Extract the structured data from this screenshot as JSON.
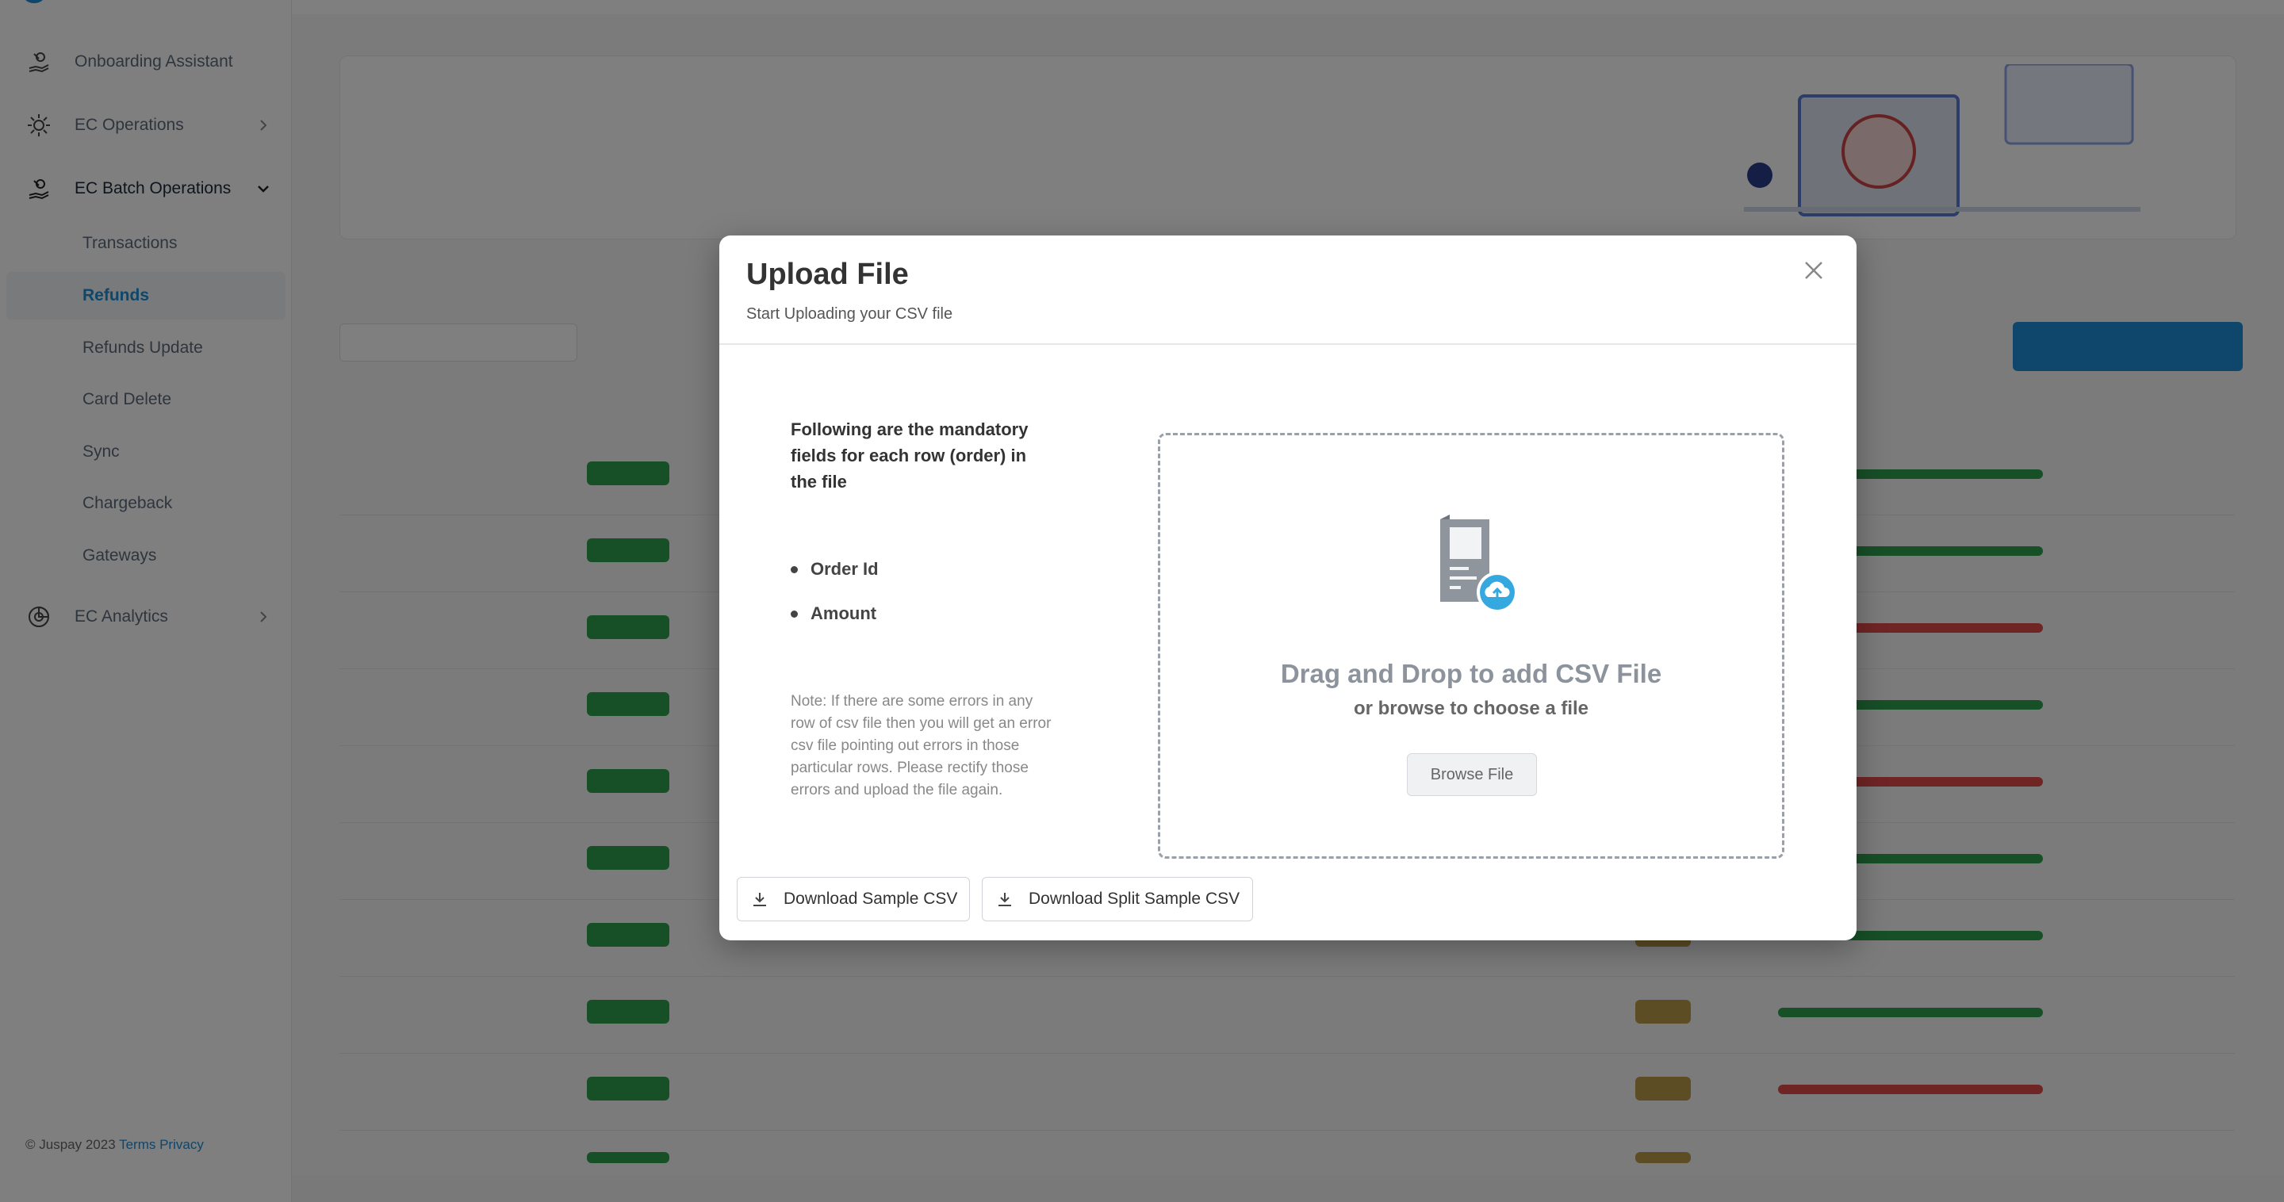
{
  "sidebar": {
    "items": [
      {
        "label": "Onboarding Assistant"
      },
      {
        "label": "EC Operations"
      },
      {
        "label": "EC Batch Operations"
      },
      {
        "label": "EC Analytics"
      }
    ],
    "batch_sub_items": [
      {
        "label": "Transactions"
      },
      {
        "label": "Refunds"
      },
      {
        "label": "Refunds Update"
      },
      {
        "label": "Card Delete"
      },
      {
        "label": "Sync"
      },
      {
        "label": "Chargeback"
      },
      {
        "label": "Gateways"
      }
    ],
    "footer": {
      "copyright": "© Juspay 2023",
      "terms": "Terms",
      "privacy": "Privacy"
    }
  },
  "modal": {
    "title": "Upload File",
    "subtitle": "Start Uploading your CSV file",
    "mandatory_title": "Following are the mandatory fields for each row (order) in the file",
    "fields": [
      "Order Id",
      "Amount"
    ],
    "note": "Note: If there are some errors in any row of csv file then you will get an error csv file pointing out errors in those particular rows. Please rectify those errors and upload the file again.",
    "dropzone_title": "Drag and Drop to add CSV File",
    "dropzone_sub": "or browse to choose a file",
    "browse_label": "Browse File",
    "download_sample_label": "Download Sample CSV",
    "download_split_label": "Download Split Sample CSV"
  },
  "colors": {
    "accent": "#1f8dd6",
    "success": "#2e9e4e",
    "danger": "#e14b4b"
  }
}
